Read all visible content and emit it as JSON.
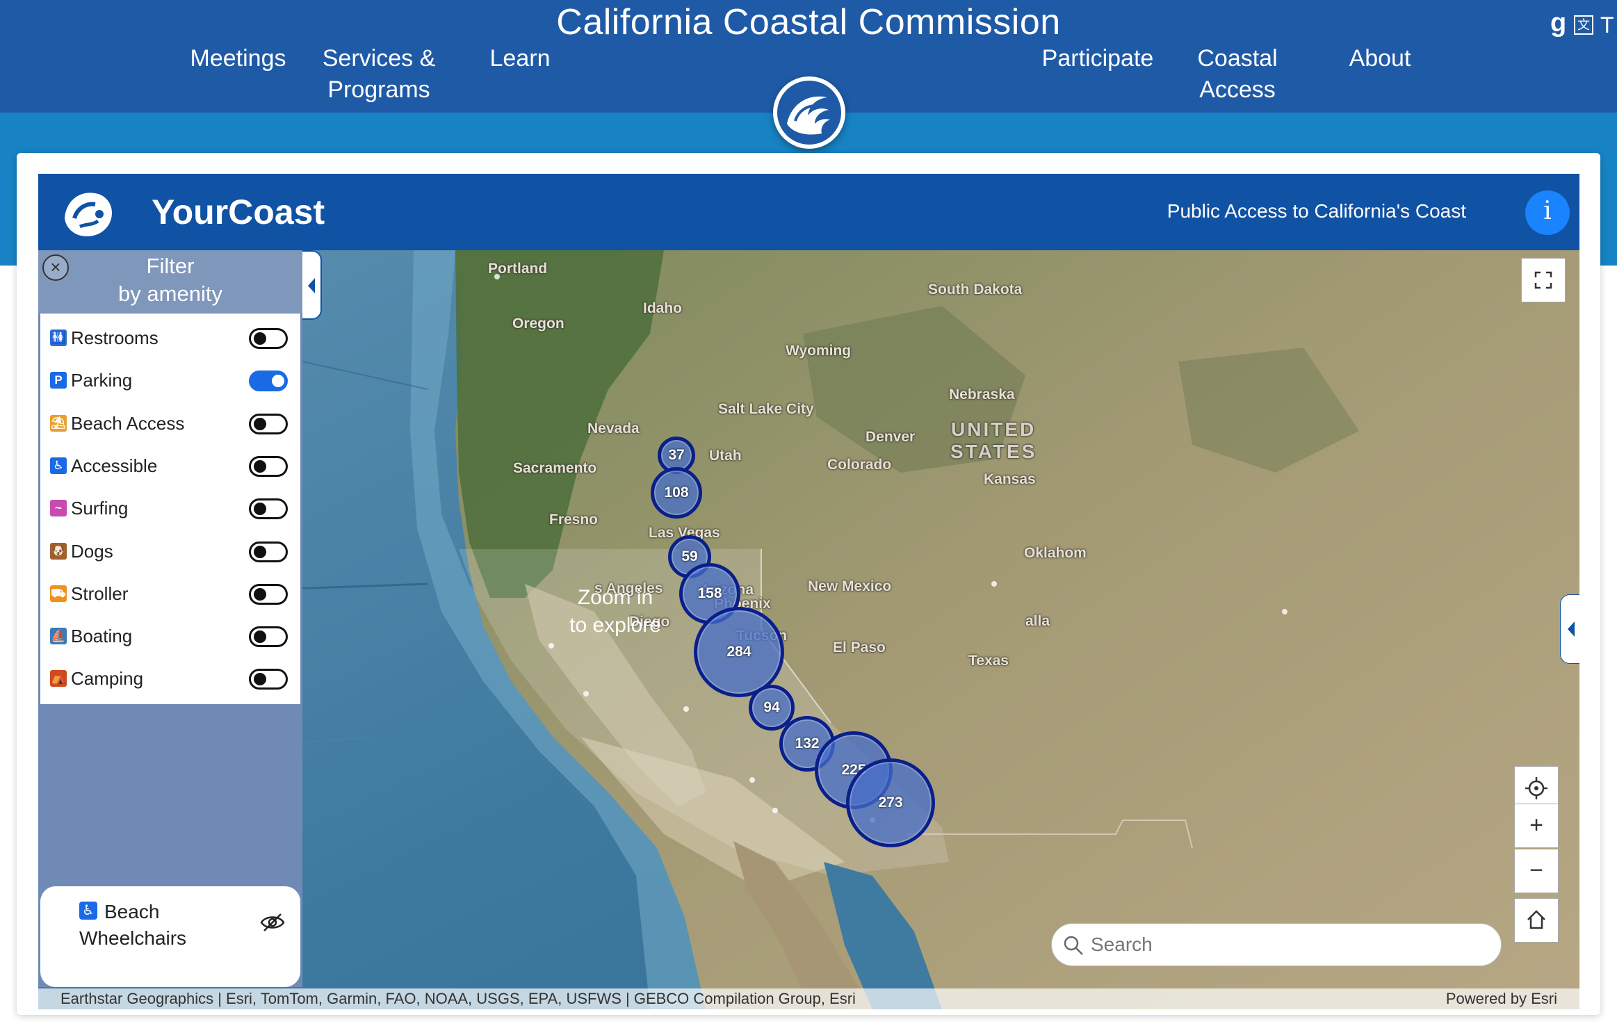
{
  "site": {
    "title": "California Coastal Commission",
    "nav": {
      "meetings": "Meetings",
      "services_1": "Services &",
      "services_2": "Programs",
      "learn": "Learn",
      "participate": "Participate",
      "coastal_1": "Coastal",
      "coastal_2": "Access",
      "about": "About"
    },
    "translate_letter": "T"
  },
  "app": {
    "title": "YourCoast",
    "subtitle": "Public Access to California's Coast",
    "info_glyph": "i"
  },
  "filter": {
    "title_1": "Filter",
    "title_2": "by amenity",
    "close_glyph": "×",
    "amenities": [
      {
        "label": "Restrooms",
        "icon": "restroom-icon",
        "enabled": false,
        "color": "#2c6fd1"
      },
      {
        "label": "Parking",
        "icon": "parking-icon",
        "enabled": true,
        "color": "#1a6ae6"
      },
      {
        "label": "Beach Access",
        "icon": "beach-access-icon",
        "enabled": false,
        "color": "#e8a030"
      },
      {
        "label": "Accessible",
        "icon": "accessible-icon",
        "enabled": false,
        "color": "#1a6ae6"
      },
      {
        "label": "Surfing",
        "icon": "surfing-icon",
        "enabled": false,
        "color": "#c84bb0"
      },
      {
        "label": "Dogs",
        "icon": "dogs-icon",
        "enabled": false,
        "color": "#a0602a"
      },
      {
        "label": "Stroller",
        "icon": "stroller-icon",
        "enabled": false,
        "color": "#f09020"
      },
      {
        "label": "Boating",
        "icon": "boating-icon",
        "enabled": false,
        "color": "#3a7ab8"
      },
      {
        "label": "Camping",
        "icon": "camping-icon",
        "enabled": false,
        "color": "#d04a20"
      }
    ],
    "wheelchairs_label": "Beach Wheelchairs",
    "wheelchairs_glyph": "♿"
  },
  "map": {
    "zoom_hint_1": "Zoom in",
    "zoom_hint_2": "to explore",
    "clusters": [
      37,
      108,
      59,
      158,
      284,
      94,
      132,
      225,
      273
    ],
    "places": {
      "portland": "Portland",
      "idaho": "Idaho",
      "oregon": "Oregon",
      "south_dakota": "South Dakota",
      "wyoming": "Wyoming",
      "nebraska": "Nebraska",
      "salt_lake": "Salt Lake City",
      "nevada": "Nevada",
      "united_1": "UNITED",
      "united_2": "STATES",
      "denver": "Denver",
      "utah": "Utah",
      "colorado": "Colorado",
      "sacramento": "Sacramento",
      "kansas": "Kansas",
      "fresno": "Fresno",
      "las_vegas": "Las Vegas",
      "oklahoma": "Oklahom",
      "los_angeles": "s Angeles",
      "arizona": "Arizona",
      "new_mexico": "New Mexico",
      "phoenix": "Phoenix",
      "san_diego": "Diego",
      "tucson": "Tucson",
      "el_paso": "El Paso",
      "texas": "Texas",
      "dallas": "alla"
    },
    "search_placeholder": "Search",
    "zoom_in": "+",
    "zoom_out": "−",
    "attribution": "Earthstar Geographics | Esri, TomTom, Garmin, FAO, NOAA, USGS, EPA, USFWS | GEBCO Compilation Group, Esri",
    "powered_by": "Powered by Esri"
  }
}
